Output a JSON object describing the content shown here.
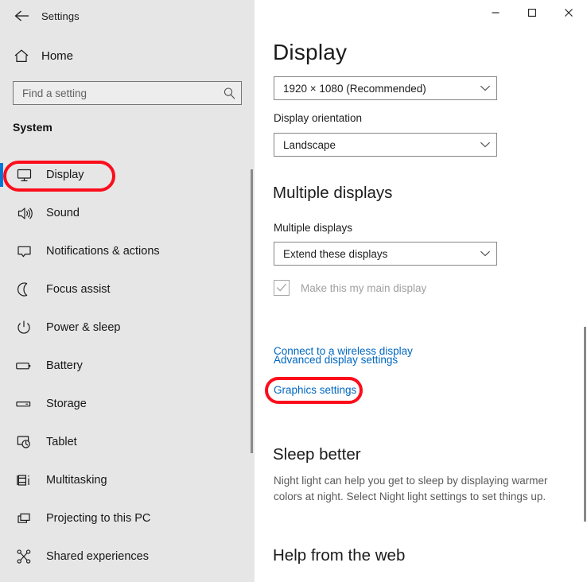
{
  "window": {
    "app_title": "Settings",
    "back_icon": "back-arrow-icon",
    "controls": {
      "minimize": "minimize-icon",
      "maximize": "maximize-icon",
      "close": "close-icon"
    }
  },
  "sidebar": {
    "home": {
      "label": "Home",
      "icon": "home-icon"
    },
    "search": {
      "value": "",
      "placeholder": "Find a setting",
      "icon": "search-icon"
    },
    "section_title": "System",
    "items": [
      {
        "label": "Display",
        "icon": "monitor-icon",
        "selected": true
      },
      {
        "label": "Sound",
        "icon": "speaker-icon",
        "selected": false
      },
      {
        "label": "Notifications & actions",
        "icon": "chat-bubble-icon",
        "selected": false
      },
      {
        "label": "Focus assist",
        "icon": "moon-icon",
        "selected": false
      },
      {
        "label": "Power & sleep",
        "icon": "power-icon",
        "selected": false
      },
      {
        "label": "Battery",
        "icon": "battery-icon",
        "selected": false
      },
      {
        "label": "Storage",
        "icon": "drive-icon",
        "selected": false
      },
      {
        "label": "Tablet",
        "icon": "tablet-touch-icon",
        "selected": false
      },
      {
        "label": "Multitasking",
        "icon": "multitasking-icon",
        "selected": false
      },
      {
        "label": "Projecting to this PC",
        "icon": "projecting-icon",
        "selected": false
      },
      {
        "label": "Shared experiences",
        "icon": "share-nodes-icon",
        "selected": false
      }
    ]
  },
  "main": {
    "page_title": "Display",
    "resolution": {
      "value": "1920 × 1080 (Recommended)",
      "chevron": "chevron-down-icon"
    },
    "orientation": {
      "label": "Display orientation",
      "value": "Landscape",
      "chevron": "chevron-down-icon"
    },
    "multiple_displays": {
      "heading": "Multiple displays",
      "label": "Multiple displays",
      "value": "Extend these displays",
      "chevron": "chevron-down-icon",
      "checkbox": {
        "label": "Make this my main display",
        "checked": true,
        "disabled": true,
        "icon": "checkmark-icon"
      }
    },
    "links": [
      {
        "label": "Connect to a wireless display"
      },
      {
        "label": "Advanced display settings"
      },
      {
        "label": "Graphics settings"
      }
    ],
    "sleep_better": {
      "heading": "Sleep better",
      "text": "Night light can help you get to sleep by displaying warmer colors at night. Select Night light settings to set things up."
    },
    "help_heading": "Help from the web"
  },
  "annotations": [
    {
      "target": "Display",
      "color": "#fc0d1b",
      "shape": "rounded-rect"
    },
    {
      "target": "Graphics settings",
      "color": "#fc0d1b",
      "shape": "rounded-rect"
    }
  ],
  "colors": {
    "accent": "#0078d7",
    "link": "#0067c0",
    "annotation": "#fc0d1b",
    "sidebar_bg": "#e6e6e6",
    "panel_bg": "#ffffff"
  }
}
